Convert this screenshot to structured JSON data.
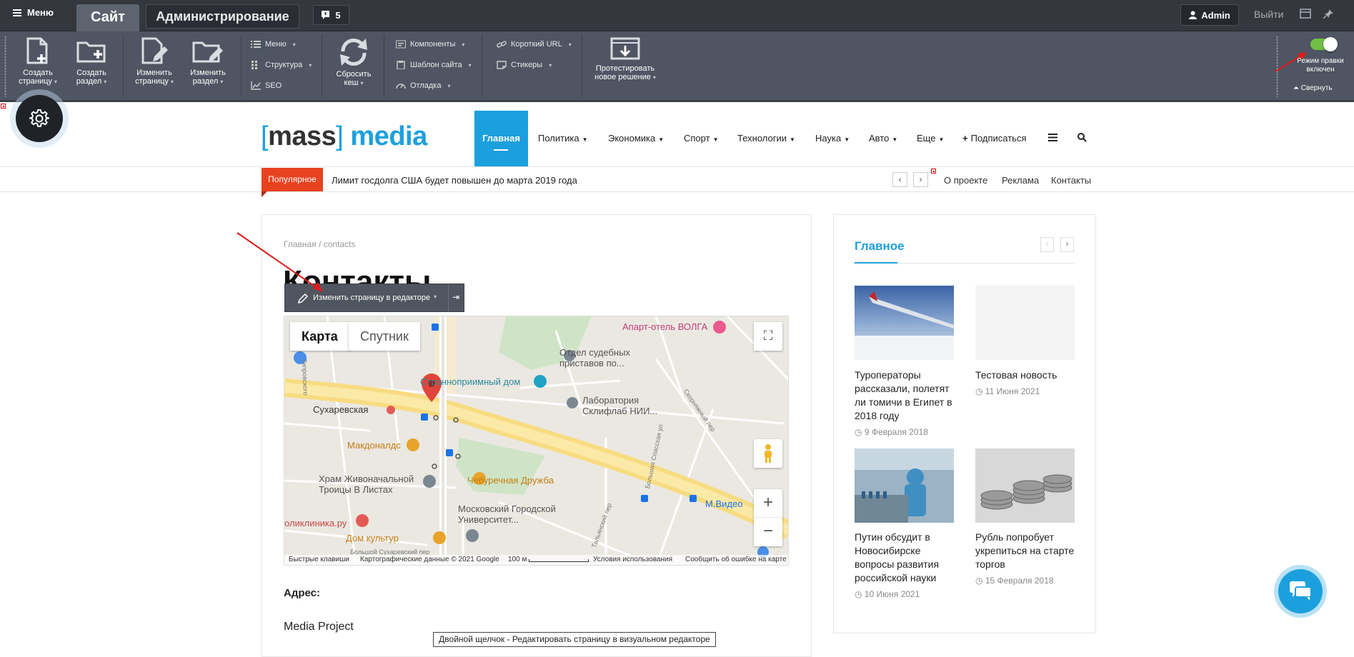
{
  "topbar": {
    "menu_label": "Меню",
    "tab_site": "Сайт",
    "tab_admin": "Администрирование",
    "notifications_count": "5",
    "user_label": "Admin",
    "exit_label": "Выйти"
  },
  "panel": {
    "create_page": "Создать страницу",
    "create_section": "Создать раздел",
    "edit_page": "Изменить страницу",
    "edit_section": "Изменить раздел",
    "menu": "Меню",
    "structure": "Структура",
    "seo": "SEO",
    "reset_cache": "Сбросить кеш",
    "components": "Компоненты",
    "site_template": "Шаблон сайта",
    "debug": "Отладка",
    "short_url": "Короткий URL",
    "stickers": "Стикеры",
    "test_solution": "Протестировать новое решение",
    "edit_mode": "Режим правки включен",
    "collapse": "Свернуть"
  },
  "site": {
    "logo_left": "[",
    "logo_mass": "mass",
    "logo_right": "]",
    "logo_media": "media",
    "nav_home": "Главная",
    "nav": [
      "Политика",
      "Экономика",
      "Спорт",
      "Технологии",
      "Наука",
      "Авто",
      "Еще"
    ],
    "subscribe": "Подписаться",
    "popular": "Популярное",
    "ticker_text": "Лимит госдолга США будет повышен до марта 2019 года",
    "top_links": [
      "О проекте",
      "Реклама",
      "Контакты"
    ]
  },
  "content": {
    "breadcrumb_home": "Главная",
    "breadcrumb_sep": "/",
    "breadcrumb_current": "contacts",
    "title": "Контакты",
    "edit_in_editor": "Изменить страницу в редакторе",
    "address_label": "Адрес:",
    "company": "Media Project",
    "dblclick_hint": "Двойной щелчок - Редактировать страницу в визуальном редакторе"
  },
  "map": {
    "tab_map": "Карта",
    "tab_satellite": "Спутник",
    "labels": {
      "hotel": "Апарт-отель ВОЛГА",
      "court": "Отдел судебных приставов по...",
      "strannopriimny": "Странноприимный дом",
      "lab": "Лаборатория Склифлаб НИИ...",
      "sukharevskaya": "Сухаревская",
      "mcdonalds": "Макдоналдс",
      "cheburechnaya": "Чебуречная Дружба",
      "church": "Храм Живоначальной Троицы В Листах",
      "university": "Московский Городской Университет...",
      "clinic": "оликлиника.ру",
      "culture": "Дом культур",
      "mvideo": "М.Видео",
      "street1": "Скорняжный пер",
      "street2": "Большая Спасская ул",
      "street3": "Большой Сухаревский пер",
      "street4": "Гипровского",
      "street5": "Тальянский пер"
    },
    "footer": {
      "shortcuts": "Быстрые клавиши",
      "copyright": "Картографические данные © 2021 Google",
      "scale": "100 м",
      "terms": "Условия использования",
      "report": "Сообщить об ошибке на карте"
    }
  },
  "sidebar": {
    "title": "Главное",
    "news": [
      {
        "title": "Туроператоры рассказали, полетят ли томичи в Египет в 2018 году",
        "date": "9 Февраля 2018"
      },
      {
        "title": "Тестовая новость",
        "date": "11 Июня 2021"
      },
      {
        "title": "Путин обсудит в Новосибирске вопросы развития российской науки",
        "date": "10 Июня 2021"
      },
      {
        "title": "Рубль попробует укрепиться на старте торгов",
        "date": "15 Февраля 2018"
      }
    ]
  },
  "colors": {
    "accent": "#1ca0dd",
    "popular_badge": "#e8421f",
    "admin_bar": "#34383e",
    "toolbar_panel": "#4f5562",
    "toggle_on": "#6fbf45",
    "annotation_arrow": "#e01b1b"
  }
}
